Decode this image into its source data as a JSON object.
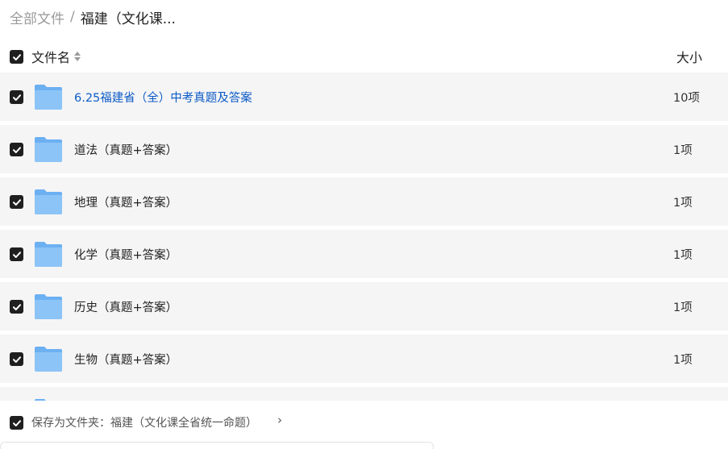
{
  "breadcrumb": {
    "root": "全部文件",
    "separator": "/",
    "current": "福建（文化课..."
  },
  "header": {
    "name_label": "文件名",
    "size_label": "大小",
    "sort_icon": "sort-icon",
    "checkbox_checked": true
  },
  "rows": [
    {
      "name": "6.25福建省（全）中考真题及答案",
      "size": "10项",
      "checked": true,
      "icon": "folder-icon"
    },
    {
      "name": "道法（真题+答案）",
      "size": "1项",
      "checked": true,
      "icon": "folder-icon"
    },
    {
      "name": "地理（真题+答案）",
      "size": "1项",
      "checked": true,
      "icon": "folder-icon"
    },
    {
      "name": "化学（真题+答案）",
      "size": "1项",
      "checked": true,
      "icon": "folder-icon"
    },
    {
      "name": "历史（真题+答案）",
      "size": "1项",
      "checked": true,
      "icon": "folder-icon"
    },
    {
      "name": "生物（真题+答案）",
      "size": "1项",
      "checked": true,
      "icon": "folder-icon"
    },
    {
      "name": "",
      "size": "",
      "checked": true,
      "icon": "folder-icon"
    }
  ],
  "footer": {
    "save_label": "保存为文件夹：福建（文化课全省统一命题）",
    "chevron": "›",
    "checked": true
  },
  "colors": {
    "link": "#0e5cc7",
    "row_bg": "#f5f5f6",
    "checkbox": "#1f1f1f",
    "folder": "#7ab8f5"
  }
}
